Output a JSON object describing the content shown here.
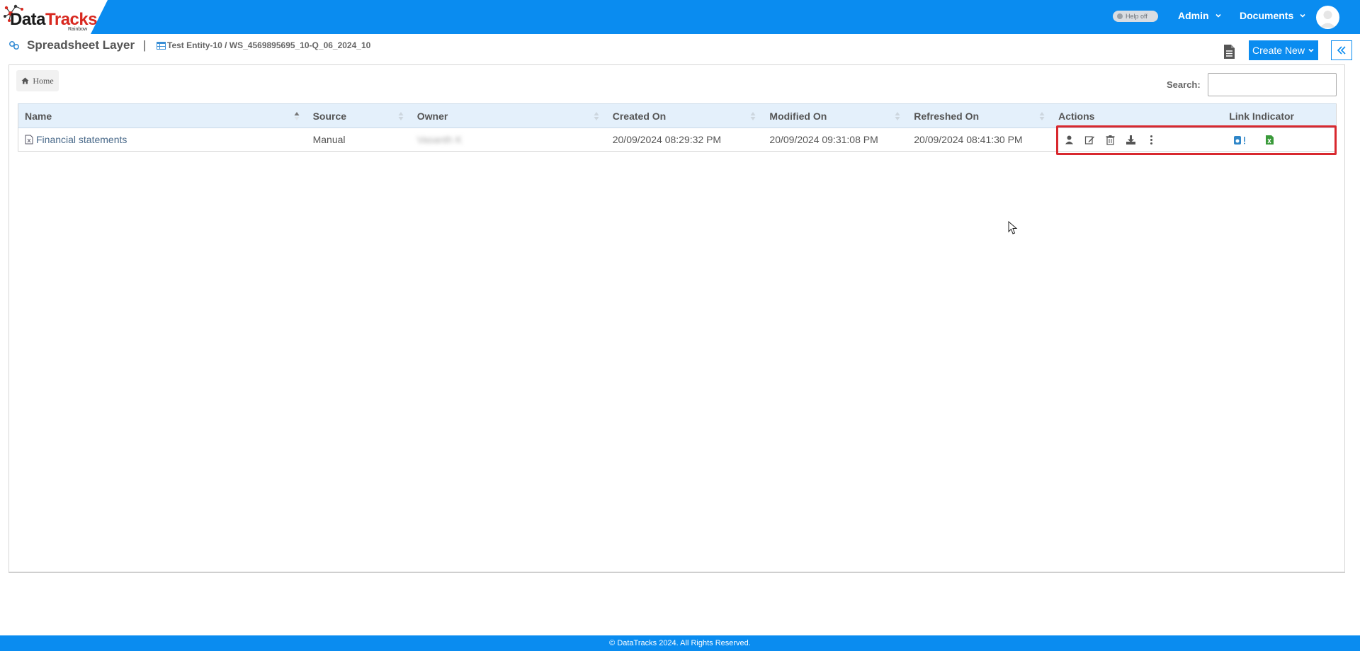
{
  "brand": {
    "name_part1": "Data",
    "name_part2": "Tracks",
    "sub": "Rainbow",
    "accent": "#0a8cf0",
    "logo_red": "#d8281f"
  },
  "topbar": {
    "help_toggle": "Help off",
    "menus": [
      {
        "label": "Admin"
      },
      {
        "label": "Documents"
      }
    ]
  },
  "header": {
    "title": "Spreadsheet Layer",
    "separator": "|",
    "entity_path": "Test Entity-10 / WS_4569895695_10-Q_06_2024_10",
    "create_new": "Create New"
  },
  "breadcrumb": {
    "home": "Home"
  },
  "search": {
    "label": "Search:",
    "value": ""
  },
  "table": {
    "columns": [
      "Name",
      "Source",
      "Owner",
      "Created On",
      "Modified On",
      "Refreshed On",
      "Actions",
      "Link Indicator"
    ],
    "rows": [
      {
        "name": "Financial statements",
        "source": "Manual",
        "owner": "Vasanth K",
        "created_on": "20/09/2024 08:29:32 PM",
        "modified_on": "20/09/2024 09:31:08 PM",
        "refreshed_on": "20/09/2024 08:41:30 PM",
        "actions": [
          "user-icon",
          "edit-icon",
          "delete-icon",
          "download-icon",
          "more-icon"
        ],
        "link_indicators": [
          "link-warning-icon",
          "excel-link-icon"
        ]
      }
    ]
  },
  "footer": {
    "copyright": "© DataTracks 2024. All Rights Reserved."
  }
}
